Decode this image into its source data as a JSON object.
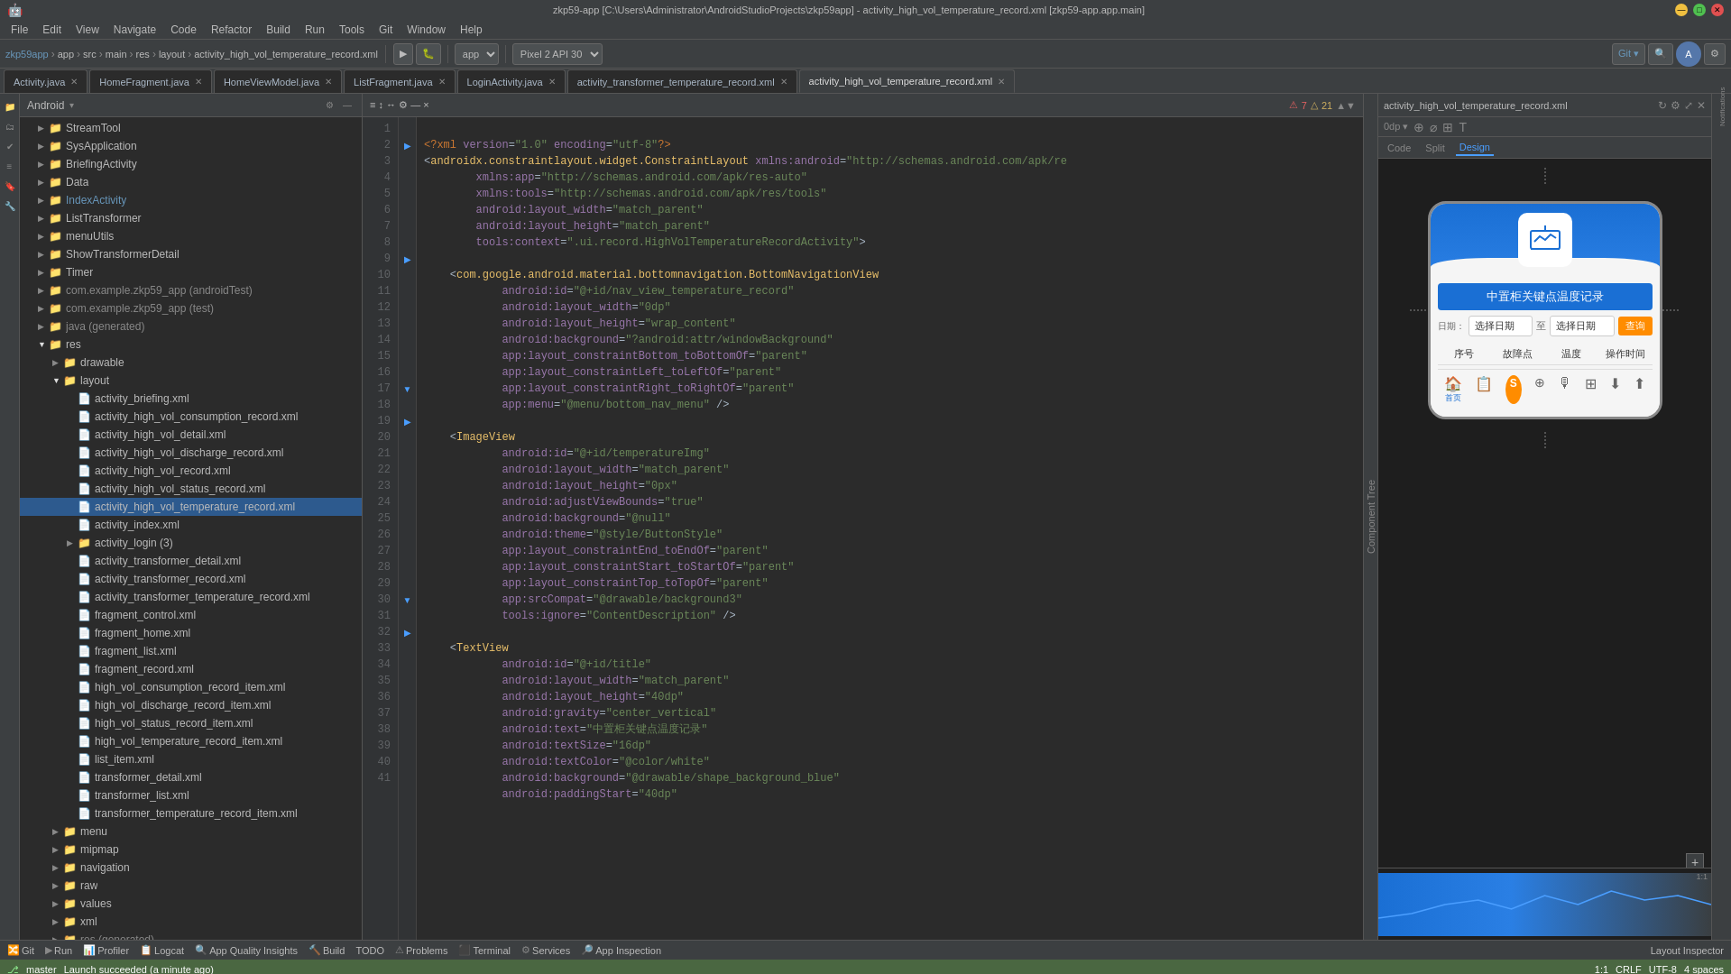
{
  "titleBar": {
    "title": "zkp59-app [C:\\Users\\Administrator\\AndroidStudioProjects\\zkp59app] - activity_high_vol_temperature_record.xml [zkp59-app.app.main]",
    "minBtn": "—",
    "maxBtn": "□",
    "closeBtn": "✕"
  },
  "menuBar": {
    "items": [
      "File",
      "Edit",
      "View",
      "Navigate",
      "Code",
      "Refactor",
      "Build",
      "Run",
      "Tools",
      "Git",
      "Window",
      "Help"
    ]
  },
  "toolbar": {
    "appName": "zkp59app",
    "moduleName": "app",
    "srcPath": "src",
    "mainPath": "main",
    "resPath": "res",
    "layoutPath": "layout",
    "filename": "activity_high_vol_temperature_record.xml",
    "deviceName": "Pixel 2 API 30",
    "runBtn": "▶",
    "debugBtn": "🐛"
  },
  "tabs": [
    {
      "label": "Activity.java",
      "active": false,
      "closeable": true
    },
    {
      "label": "HomeFragment.java",
      "active": false,
      "closeable": true
    },
    {
      "label": "HomeViewModel.java",
      "active": false,
      "closeable": true
    },
    {
      "label": "ListFragment.java",
      "active": false,
      "closeable": true
    },
    {
      "label": "LoginActivity.java",
      "active": false,
      "closeable": true
    },
    {
      "label": "activity_transformer_temperature_record.xml",
      "active": false,
      "closeable": true
    },
    {
      "label": "activity_high_vol_temperature_record.xml",
      "active": true,
      "closeable": true
    }
  ],
  "fileTree": {
    "title": "Android",
    "items": [
      {
        "indent": 0,
        "arrow": "▶",
        "icon": "📁",
        "label": "StreamTool",
        "type": "folder"
      },
      {
        "indent": 0,
        "arrow": "▶",
        "icon": "📁",
        "label": "SysApplication",
        "type": "folder"
      },
      {
        "indent": 0,
        "arrow": "▶",
        "icon": "📁",
        "label": "BriefingActivity",
        "type": "folder"
      },
      {
        "indent": 0,
        "arrow": "▶",
        "icon": "📁",
        "label": "Data",
        "type": "folder"
      },
      {
        "indent": 0,
        "arrow": "▶",
        "icon": "📁",
        "label": "IndexActivity",
        "type": "folder",
        "blue": true
      },
      {
        "indent": 0,
        "arrow": "▶",
        "icon": "📁",
        "label": "ListTransformer",
        "type": "folder"
      },
      {
        "indent": 0,
        "arrow": "▶",
        "icon": "📁",
        "label": "menuUtils",
        "type": "folder"
      },
      {
        "indent": 0,
        "arrow": "▶",
        "icon": "📁",
        "label": "ShowTransformerDetail",
        "type": "folder"
      },
      {
        "indent": 0,
        "arrow": "▶",
        "icon": "📁",
        "label": "Timer",
        "type": "folder"
      },
      {
        "indent": 0,
        "arrow": "▶",
        "icon": "📁",
        "label": "com.example.zkp59_app (androidTest)",
        "type": "folder"
      },
      {
        "indent": 0,
        "arrow": "▶",
        "icon": "📁",
        "label": "com.example.zkp59_app (test)",
        "type": "folder"
      },
      {
        "indent": 0,
        "arrow": "▶",
        "icon": "📁",
        "label": "java (generated)",
        "type": "folder"
      },
      {
        "indent": 0,
        "arrow": "▼",
        "icon": "📁",
        "label": "res",
        "type": "folder"
      },
      {
        "indent": 1,
        "arrow": "▶",
        "icon": "📁",
        "label": "drawable",
        "type": "folder"
      },
      {
        "indent": 1,
        "arrow": "▼",
        "icon": "📁",
        "label": "layout",
        "type": "folder"
      },
      {
        "indent": 2,
        "arrow": "",
        "icon": "📄",
        "label": "activity_briefing.xml",
        "type": "xml"
      },
      {
        "indent": 2,
        "arrow": "",
        "icon": "📄",
        "label": "activity_high_vol_consumption_record.xml",
        "type": "xml"
      },
      {
        "indent": 2,
        "arrow": "",
        "icon": "📄",
        "label": "activity_high_vol_detail.xml",
        "type": "xml"
      },
      {
        "indent": 2,
        "arrow": "",
        "icon": "📄",
        "label": "activity_high_vol_discharge_record.xml",
        "type": "xml"
      },
      {
        "indent": 2,
        "arrow": "",
        "icon": "📄",
        "label": "activity_high_vol_record.xml",
        "type": "xml"
      },
      {
        "indent": 2,
        "arrow": "",
        "icon": "📄",
        "label": "activity_high_vol_status_record.xml",
        "type": "xml"
      },
      {
        "indent": 2,
        "arrow": "",
        "icon": "📄",
        "label": "activity_high_vol_temperature_record.xml",
        "type": "xml",
        "selected": true
      },
      {
        "indent": 2,
        "arrow": "",
        "icon": "📄",
        "label": "activity_index.xml",
        "type": "xml"
      },
      {
        "indent": 2,
        "arrow": "▶",
        "icon": "📁",
        "label": "activity_login (3)",
        "type": "folder"
      },
      {
        "indent": 2,
        "arrow": "",
        "icon": "📄",
        "label": "activity_transformer_detail.xml",
        "type": "xml"
      },
      {
        "indent": 2,
        "arrow": "",
        "icon": "📄",
        "label": "activity_transformer_record.xml",
        "type": "xml"
      },
      {
        "indent": 2,
        "arrow": "",
        "icon": "📄",
        "label": "activity_transformer_temperature_record.xml",
        "type": "xml"
      },
      {
        "indent": 2,
        "arrow": "",
        "icon": "📄",
        "label": "fragment_control.xml",
        "type": "xml"
      },
      {
        "indent": 2,
        "arrow": "",
        "icon": "📄",
        "label": "fragment_home.xml",
        "type": "xml"
      },
      {
        "indent": 2,
        "arrow": "",
        "icon": "📄",
        "label": "fragment_list.xml",
        "type": "xml"
      },
      {
        "indent": 2,
        "arrow": "",
        "icon": "📄",
        "label": "fragment_record.xml",
        "type": "xml"
      },
      {
        "indent": 2,
        "arrow": "",
        "icon": "📄",
        "label": "high_vol_consumption_record_item.xml",
        "type": "xml"
      },
      {
        "indent": 2,
        "arrow": "",
        "icon": "📄",
        "label": "high_vol_discharge_record_item.xml",
        "type": "xml"
      },
      {
        "indent": 2,
        "arrow": "",
        "icon": "📄",
        "label": "high_vol_status_record_item.xml",
        "type": "xml"
      },
      {
        "indent": 2,
        "arrow": "",
        "icon": "📄",
        "label": "high_vol_temperature_record_item.xml",
        "type": "xml"
      },
      {
        "indent": 2,
        "arrow": "",
        "icon": "📄",
        "label": "list_item.xml",
        "type": "xml"
      },
      {
        "indent": 2,
        "arrow": "",
        "icon": "📄",
        "label": "transformer_detail.xml",
        "type": "xml"
      },
      {
        "indent": 2,
        "arrow": "",
        "icon": "📄",
        "label": "transformer_list.xml",
        "type": "xml"
      },
      {
        "indent": 2,
        "arrow": "",
        "icon": "📄",
        "label": "transformer_temperature_record_item.xml",
        "type": "xml"
      },
      {
        "indent": 1,
        "arrow": "▶",
        "icon": "📁",
        "label": "menu",
        "type": "folder"
      },
      {
        "indent": 1,
        "arrow": "▶",
        "icon": "📁",
        "label": "mipmap",
        "type": "folder"
      },
      {
        "indent": 1,
        "arrow": "▶",
        "icon": "📁",
        "label": "navigation",
        "type": "folder"
      },
      {
        "indent": 1,
        "arrow": "▶",
        "icon": "📁",
        "label": "raw",
        "type": "folder"
      },
      {
        "indent": 1,
        "arrow": "▶",
        "icon": "📁",
        "label": "values",
        "type": "folder"
      },
      {
        "indent": 1,
        "arrow": "▶",
        "icon": "📁",
        "label": "xml",
        "type": "folder"
      },
      {
        "indent": 1,
        "arrow": "▶",
        "icon": "📁",
        "label": "res (generated)",
        "type": "folder"
      }
    ]
  },
  "codeLines": [
    {
      "num": 1,
      "content": "<?xml version=\"1.0\" encoding=\"utf-8\"?>"
    },
    {
      "num": 2,
      "content": "<androidx.constraintlayout.widget.ConstraintLayout xmlns:android=\"http://schemas.android.com/apk/re",
      "indicator": "arrow"
    },
    {
      "num": 3,
      "content": "    xmlns:app=\"http://schemas.android.com/apk/res-auto\""
    },
    {
      "num": 4,
      "content": "    xmlns:tools=\"http://schemas.android.com/apk/res/tools\""
    },
    {
      "num": 5,
      "content": "    android:layout_width=\"match_parent\""
    },
    {
      "num": 6,
      "content": "    android:layout_height=\"match_parent\""
    },
    {
      "num": 7,
      "content": "    tools:context=\".ui.record.HighVolTemperatureRecordActivity\">"
    },
    {
      "num": 8,
      "content": ""
    },
    {
      "num": 9,
      "content": "    <com.google.android.material.bottomnavigation.BottomNavigationView"
    },
    {
      "num": 10,
      "content": "        android:id=\"@+id/nav_view_temperature_record\""
    },
    {
      "num": 11,
      "content": "        android:layout_width=\"0dp\""
    },
    {
      "num": 12,
      "content": "        android:layout_height=\"wrap_content\""
    },
    {
      "num": 13,
      "content": "        android:background=\"?android:attr/windowBackground\""
    },
    {
      "num": 14,
      "content": "        app:layout_constraintBottom_toBottomOf=\"parent\""
    },
    {
      "num": 15,
      "content": "        app:layout_constraintLeft_toLeftOf=\"parent\""
    },
    {
      "num": 16,
      "content": "        app:layout_constraintRight_toRightOf=\"parent\""
    },
    {
      "num": 17,
      "content": "        app:menu=\"@menu/bottom_nav_menu\" />"
    },
    {
      "num": 18,
      "content": ""
    },
    {
      "num": 19,
      "content": "    <ImageView"
    },
    {
      "num": 20,
      "content": "        android:id=\"@+id/temperatureImg\""
    },
    {
      "num": 21,
      "content": "        android:layout_width=\"match_parent\""
    },
    {
      "num": 22,
      "content": "        android:layout_height=\"0px\""
    },
    {
      "num": 23,
      "content": "        android:adjustViewBounds=\"true\""
    },
    {
      "num": 24,
      "content": "        android:background=\"@null\""
    },
    {
      "num": 25,
      "content": "        android:theme=\"@style/ButtonStyle\""
    },
    {
      "num": 26,
      "content": "        app:layout_constraintEnd_toEndOf=\"parent\""
    },
    {
      "num": 27,
      "content": "        app:layout_constraintStart_toStartOf=\"parent\""
    },
    {
      "num": 28,
      "content": "        app:layout_constraintTop_toTopOf=\"parent\""
    },
    {
      "num": 29,
      "content": "        app:srcCompat=\"@drawable/background3\""
    },
    {
      "num": 30,
      "content": "        tools:ignore=\"ContentDescription\" />"
    },
    {
      "num": 31,
      "content": ""
    },
    {
      "num": 32,
      "content": "    <TextView"
    },
    {
      "num": 33,
      "content": "        android:id=\"@+id/title\""
    },
    {
      "num": 34,
      "content": "        android:layout_width=\"match_parent\""
    },
    {
      "num": 35,
      "content": "        android:layout_height=\"40dp\""
    },
    {
      "num": 36,
      "content": "        android:gravity=\"center_vertical\""
    },
    {
      "num": 37,
      "content": "        android:text=\"中置柜关键点温度记录\""
    },
    {
      "num": 38,
      "content": "        android:textSize=\"16dp\""
    },
    {
      "num": 39,
      "content": "        android:textColor=\"@color/white\""
    },
    {
      "num": 40,
      "content": "        android:background=\"@drawable/shape_background_blue\""
    },
    {
      "num": 41,
      "content": "        android:paddingStart=\"40dp\""
    }
  ],
  "errorBadge": {
    "errors": "7",
    "warnings": "21"
  },
  "previewPanel": {
    "filename": "activity_high_vol_temperature_record.xml",
    "tabs": [
      "Code",
      "Split",
      "Design"
    ],
    "activeTab": "Design",
    "zoomLevel": "1:1"
  },
  "phonePreview": {
    "title": "中置柜关键点温度记录",
    "searchBar": {
      "fromDate": "选择日期",
      "toDate": "选择日期",
      "separator": "至",
      "searchBtn": "查询"
    },
    "tableHeaders": [
      "序号",
      "故障点",
      "温度",
      "操作时间"
    ],
    "navItems": [
      {
        "icon": "🏠",
        "label": "首页",
        "active": true
      },
      {
        "icon": "📋",
        "label": "",
        "active": false
      },
      {
        "icon": "S",
        "label": "",
        "active": false
      },
      {
        "icon": "·+",
        "label": "",
        "active": false
      },
      {
        "icon": "🎙",
        "label": "",
        "active": false
      },
      {
        "icon": "⊞",
        "label": "",
        "active": false
      },
      {
        "icon": "⬇",
        "label": "",
        "active": false
      },
      {
        "icon": "⬆",
        "label": "",
        "active": false
      }
    ]
  },
  "bottomBar": {
    "items": [
      {
        "label": "Git",
        "icon": "git"
      },
      {
        "label": "Run",
        "icon": "run"
      },
      {
        "label": "Profiler",
        "icon": "profiler"
      },
      {
        "label": "Logcat",
        "icon": "logcat"
      },
      {
        "label": "App Quality Insights",
        "icon": "quality"
      },
      {
        "label": "Build",
        "icon": "build"
      },
      {
        "label": "TODO",
        "icon": "todo"
      },
      {
        "label": "Problems",
        "icon": "problems"
      },
      {
        "label": "Terminal",
        "icon": "terminal"
      },
      {
        "label": "Services",
        "icon": "services"
      },
      {
        "label": "App Inspection",
        "icon": "inspection"
      }
    ]
  },
  "statusBar": {
    "position": "1:1",
    "lineEnding": "CRLF",
    "encoding": "UTF-8",
    "indentation": "4 spaces",
    "branch": "master",
    "message": "Launch succeeded (a minute ago)"
  }
}
